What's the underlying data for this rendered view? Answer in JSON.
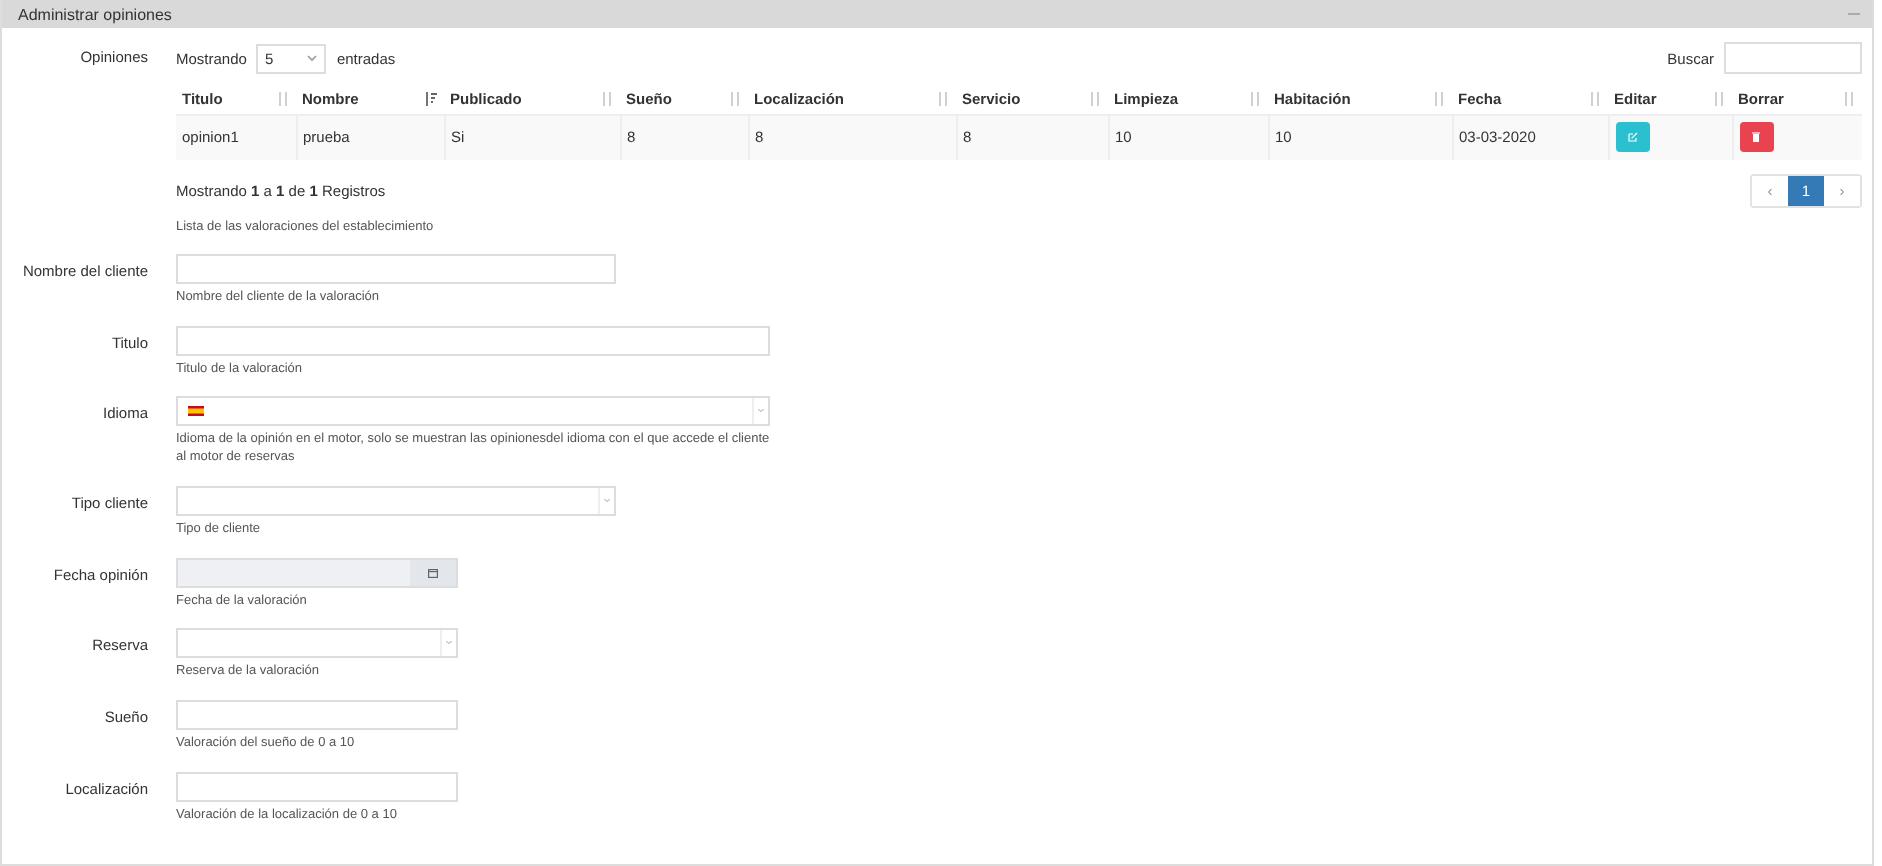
{
  "panel": {
    "title": "Administrar opiniones"
  },
  "opinions": {
    "label": "Opiniones",
    "length_prefix": "Mostrando",
    "length_value": "5",
    "length_suffix": "entradas",
    "search_label": "Buscar",
    "columns": [
      {
        "label": "Titulo",
        "sorted": false
      },
      {
        "label": "Nombre",
        "sorted": true
      },
      {
        "label": "Publicado",
        "sorted": false
      },
      {
        "label": "Sueño",
        "sorted": false
      },
      {
        "label": "Localización",
        "sorted": false
      },
      {
        "label": "Servicio",
        "sorted": false
      },
      {
        "label": "Limpieza",
        "sorted": false
      },
      {
        "label": "Habitación",
        "sorted": false
      },
      {
        "label": "Fecha",
        "sorted": false
      },
      {
        "label": "Editar",
        "sorted": false
      },
      {
        "label": "Borrar",
        "sorted": false
      }
    ],
    "rows": [
      {
        "cells": [
          "opinion1",
          "prueba",
          "Si",
          "8",
          "8",
          "8",
          "10",
          "10",
          "03-03-2020"
        ],
        "actions": [
          {
            "kind": "edit"
          },
          {
            "kind": "delete"
          }
        ]
      }
    ],
    "info": "Mostrando **1** a **1** de **1** Registros",
    "pages": [
      {
        "label": "‹",
        "selected": false
      },
      {
        "label": "1",
        "selected": true
      },
      {
        "label": "›",
        "selected": false
      }
    ],
    "help": "Lista de las valoraciones del establecimiento"
  },
  "fields": [
    {
      "label": "Nombre del cliente",
      "kind": "text",
      "help": "Nombre del cliente de la valoración"
    },
    {
      "label": "Titulo",
      "kind": "text",
      "help": "Titulo de la valoración"
    },
    {
      "label": "Idioma",
      "kind": "flag-select",
      "help": "Idioma de la opinión en el motor, solo se muestran las opinionesdel idioma con el que accede el cliente al motor de reservas"
    },
    {
      "label": "Tipo cliente",
      "kind": "select",
      "help": "Tipo de cliente"
    },
    {
      "label": "Fecha opinión",
      "kind": "date",
      "help": "Fecha de la valoración"
    },
    {
      "label": "Reserva",
      "kind": "select",
      "help": "Reserva de la valoración"
    },
    {
      "label": "Sueño",
      "kind": "text",
      "help": "Valoración del sueño de 0 a 10"
    },
    {
      "label": "Localización",
      "kind": "text",
      "help": "Valoración de la localización de 0 a 10"
    }
  ]
}
